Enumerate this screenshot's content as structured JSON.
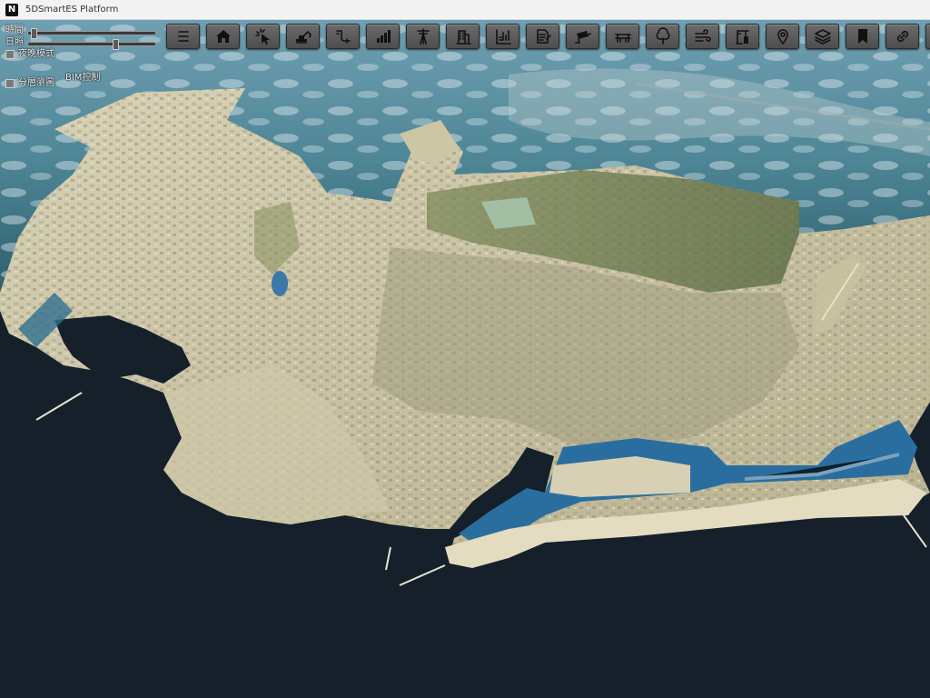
{
  "window": {
    "logo": "N",
    "title": "5DSmartES Platform"
  },
  "controls": {
    "time_label": "時間",
    "sun_label": "日照",
    "time_value_fraction": 0.02,
    "sun_value_fraction": 0.7,
    "night_mode_label": "夜晚模式",
    "bim_control_label": "BIM控制",
    "layered_label": "分層瀏圖"
  },
  "toolbar": {
    "buttons": [
      {
        "name": "menu-button",
        "icon": "menu-icon"
      },
      {
        "name": "home-button",
        "icon": "home-icon"
      },
      {
        "name": "select-button",
        "icon": "cursor-click-icon"
      },
      {
        "name": "terrain-button",
        "icon": "excavator-icon"
      },
      {
        "name": "pipeline-button",
        "icon": "pipe-icon"
      },
      {
        "name": "statistics-button",
        "icon": "bar-chart-icon"
      },
      {
        "name": "power-line-button",
        "icon": "transmission-tower-icon"
      },
      {
        "name": "building-button",
        "icon": "building-icon"
      },
      {
        "name": "water-level-button",
        "icon": "water-level-icon"
      },
      {
        "name": "document-button",
        "icon": "document-edit-icon"
      },
      {
        "name": "surveillance-button",
        "icon": "cctv-camera-icon"
      },
      {
        "name": "bridge-button",
        "icon": "bridge-icon"
      },
      {
        "name": "tree-button",
        "icon": "tree-icon"
      },
      {
        "name": "wind-button",
        "icon": "wind-icon"
      },
      {
        "name": "construction-button",
        "icon": "crane-icon"
      },
      {
        "name": "location-button",
        "icon": "map-pin-icon"
      },
      {
        "name": "layers-button",
        "icon": "layers-icon"
      },
      {
        "name": "bookmark-button",
        "icon": "bookmark-icon"
      },
      {
        "name": "link-button",
        "icon": "link-icon"
      },
      {
        "name": "more-button",
        "icon": "partial-button-icon"
      }
    ]
  }
}
